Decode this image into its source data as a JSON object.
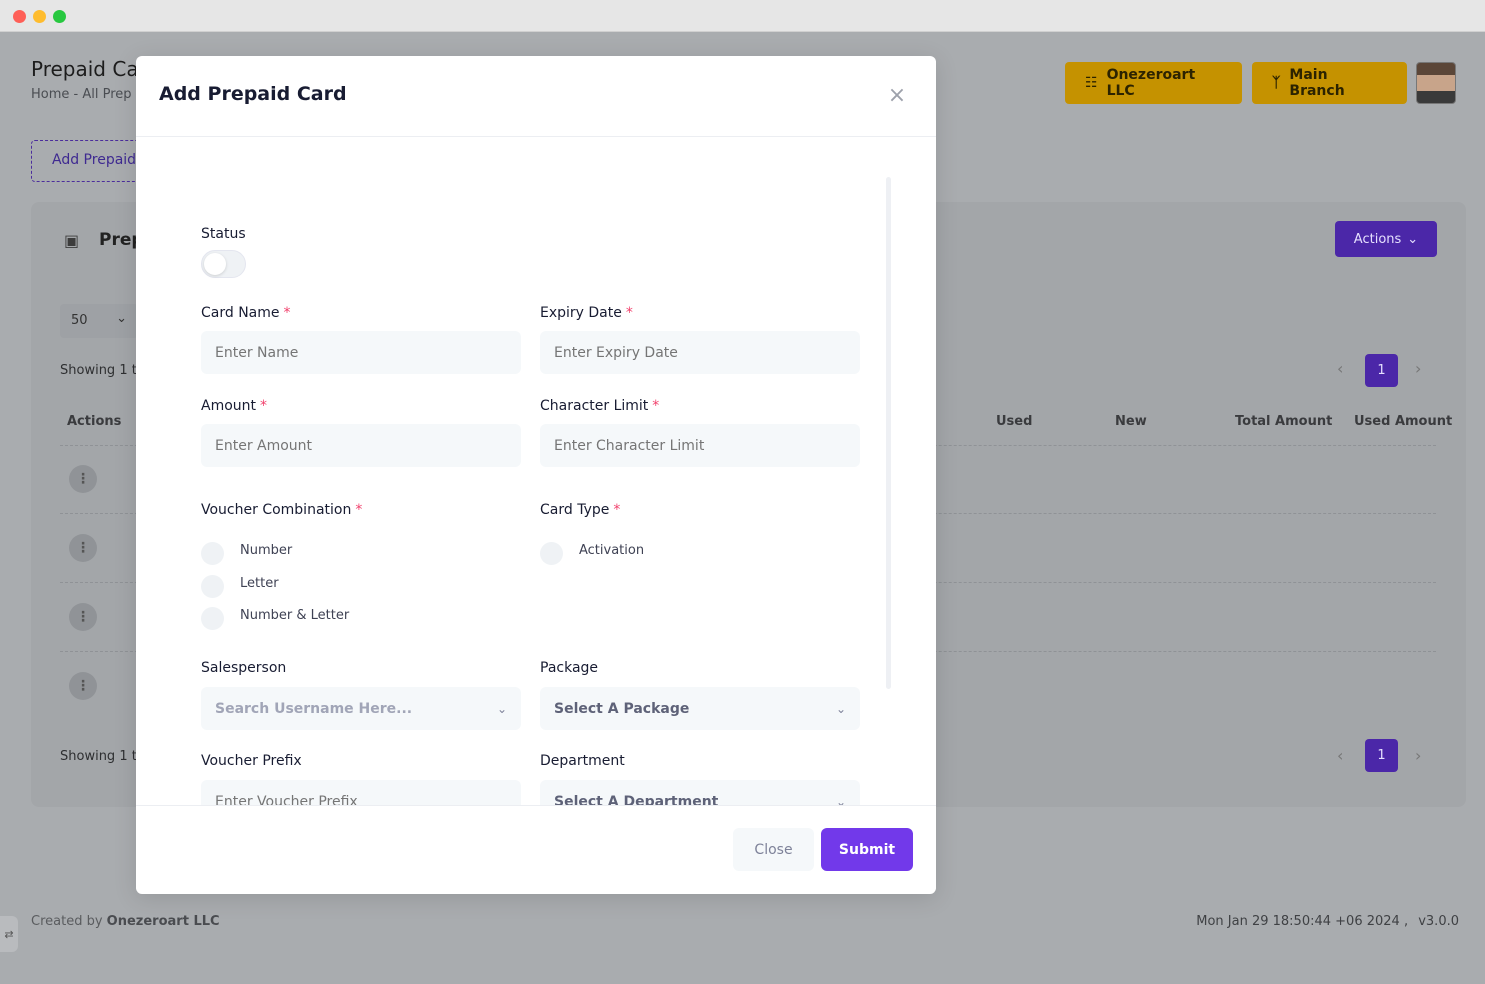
{
  "window": {
    "title": ""
  },
  "page": {
    "title": "Prepaid Ca",
    "breadcrumb": "Home  -  All Prep",
    "add_button": "Add Prepaid",
    "org_button": "Onezeroart LLC",
    "branch_button": "Main Branch",
    "card_title": "Prep",
    "actions_button": "Actions",
    "per_page": "50",
    "showing_text": "Showing 1 t",
    "showing_text_bottom": "Showing 1 t",
    "page_number": "1",
    "table_headers": [
      "Actions",
      "Used",
      "New",
      "Total Amount",
      "Used Amount"
    ],
    "footer_created_by": "Created by",
    "footer_company": "Onezeroart LLC",
    "footer_timestamp": "Mon Jan 29 18:50:44 +06 2024 ,",
    "footer_version": "v3.0.0"
  },
  "modal": {
    "title": "Add Prepaid Card",
    "fields": {
      "status_label": "Status",
      "card_name_label": "Card Name",
      "card_name_placeholder": "Enter Name",
      "expiry_date_label": "Expiry Date",
      "expiry_date_placeholder": "Enter Expiry Date",
      "amount_label": "Amount",
      "amount_placeholder": "Enter Amount",
      "char_limit_label": "Character Limit",
      "char_limit_placeholder": "Enter Character Limit",
      "voucher_combination_label": "Voucher Combination",
      "voucher_options": [
        "Number",
        "Letter",
        "Number & Letter"
      ],
      "card_type_label": "Card Type",
      "card_type_options": [
        "Activation"
      ],
      "salesperson_label": "Salesperson",
      "salesperson_placeholder": "Search Username Here...",
      "package_label": "Package",
      "package_value": "Select A Package",
      "voucher_prefix_label": "Voucher Prefix",
      "voucher_prefix_placeholder": "Enter Voucher Prefix",
      "department_label": "Department",
      "department_value": "Select A Department"
    },
    "required_mark": "*",
    "close_button": "Close",
    "submit_button": "Submit"
  },
  "colors": {
    "primary": "#7239ea",
    "accent_gold": "#c59200",
    "danger": "#f1416c"
  }
}
